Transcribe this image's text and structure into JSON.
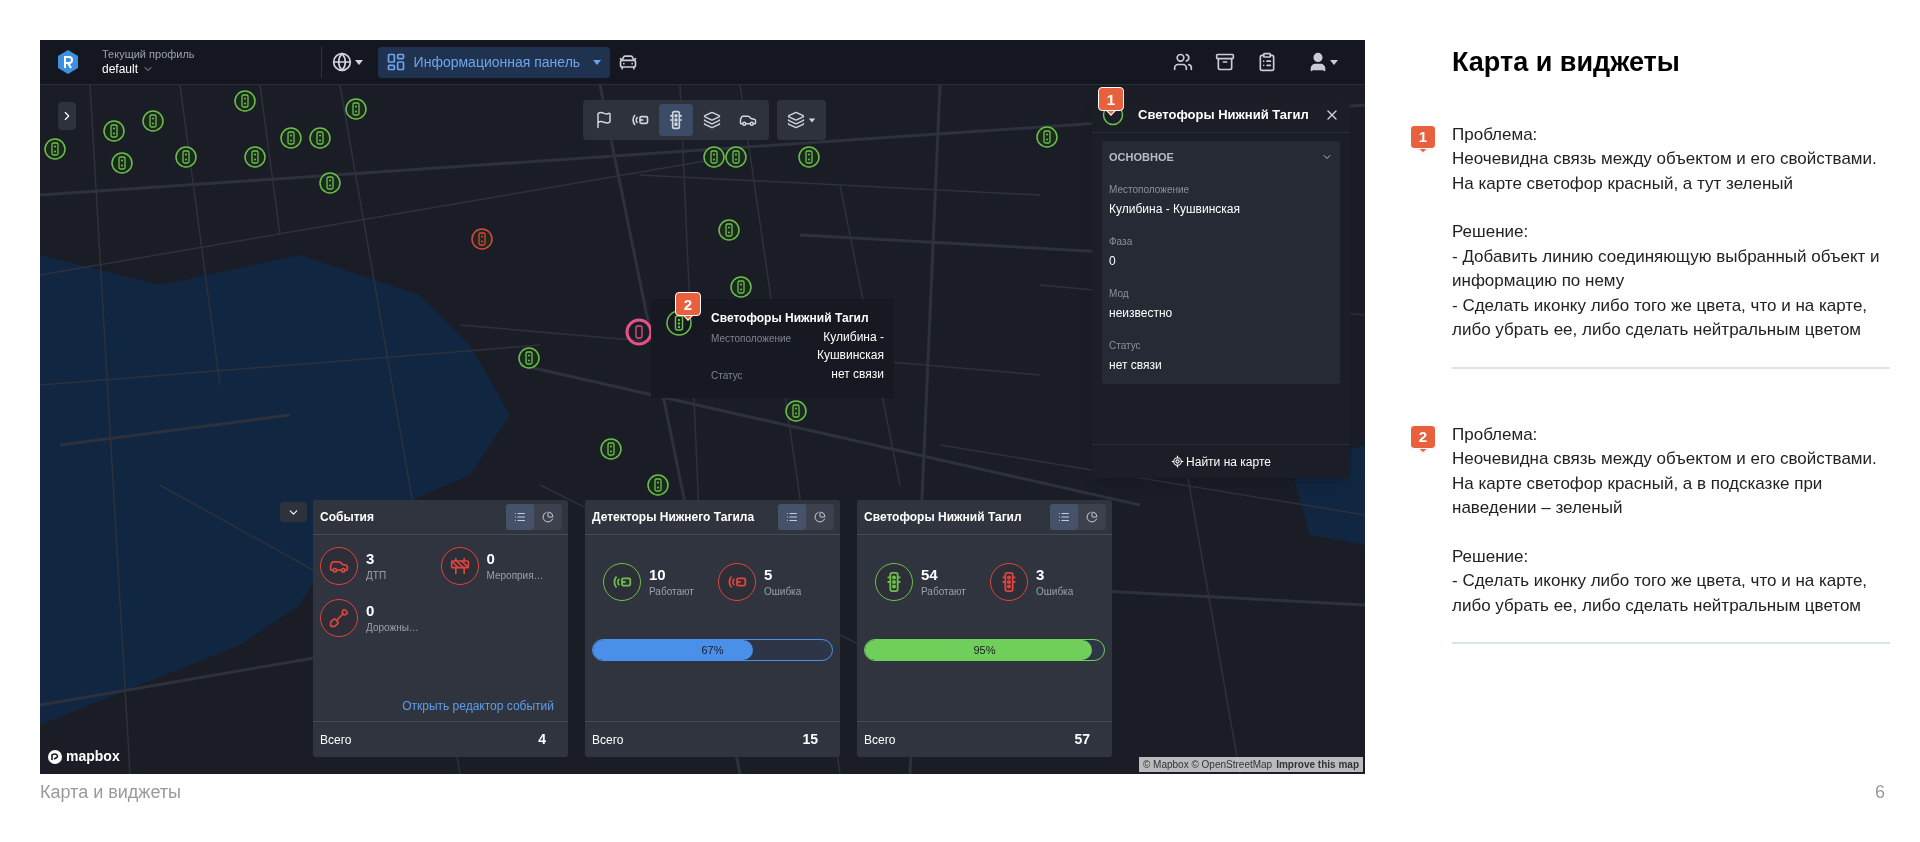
{
  "header": {
    "profile_label": "Текущий профиль",
    "profile_value": "default",
    "dashboard_button": "Информационная панель"
  },
  "map_toolbar": [
    {
      "kind": "flag",
      "selected": false
    },
    {
      "kind": "detector",
      "selected": false
    },
    {
      "kind": "traffic-light",
      "selected": true
    },
    {
      "kind": "layers",
      "selected": false
    },
    {
      "kind": "crash",
      "selected": false
    }
  ],
  "panel": {
    "callout": "1",
    "title": "Светофоры Нижний Тагил",
    "section": "ОСНОВНОЕ",
    "expanded": true,
    "fields": [
      {
        "label": "Местоположение",
        "value": "Кулибина - Кушвинская"
      },
      {
        "label": "Фаза",
        "value": "0"
      },
      {
        "label": "Мод",
        "value": "неизвестно"
      },
      {
        "label": "Статус",
        "value": "нет связи"
      }
    ],
    "find_button": "Найти на карте"
  },
  "tooltip": {
    "callout": "2",
    "title": "Светофоры Нижний Тагил",
    "rows": [
      {
        "label": "Местоположение",
        "value": "Кулибина - Кушвинская"
      },
      {
        "label": "Статус",
        "value": "нет связи"
      }
    ]
  },
  "widgets": [
    {
      "title": "События",
      "tabs": [
        {
          "kind": "list",
          "selected": true
        },
        {
          "kind": "chart",
          "selected": false
        }
      ],
      "stats": [
        {
          "value": "3",
          "label": "ДТП",
          "color": "#e0443c",
          "kind": "crash"
        },
        {
          "value": "0",
          "label": "Мероприя…",
          "color": "#e0443c",
          "kind": "barrier"
        },
        {
          "value": "0",
          "label": "Дорожны…",
          "color": "#e0443c",
          "kind": "roadwork"
        }
      ],
      "link": "Открыть редактор событий",
      "total_label": "Всего",
      "total": "4"
    },
    {
      "title": "Детекторы Нижнего Тагила",
      "tabs": [
        {
          "kind": "list",
          "selected": true
        },
        {
          "kind": "chart",
          "selected": false
        }
      ],
      "stats": [
        {
          "value": "10",
          "label": "Работают",
          "color": "#6cc04a",
          "kind": "detector"
        },
        {
          "value": "5",
          "label": "Ошибка",
          "color": "#e0443c",
          "kind": "detector"
        }
      ],
      "progress": {
        "level": 0.67,
        "label": "67%",
        "color": "#4a90ea"
      },
      "total_label": "Всего",
      "total": "15"
    },
    {
      "title": "Светофоры Нижний Тагил",
      "tabs": [
        {
          "kind": "list",
          "selected": true
        },
        {
          "kind": "chart",
          "selected": false
        }
      ],
      "stats": [
        {
          "value": "54",
          "label": "Работают",
          "color": "#6cc04a",
          "kind": "traffic-light"
        },
        {
          "value": "3",
          "label": "Ошибка",
          "color": "#e0443c",
          "kind": "traffic-light"
        }
      ],
      "progress": {
        "level": 0.95,
        "label": "95%",
        "color": "#6fcf5a"
      },
      "total_label": "Всего",
      "total": "57"
    }
  ],
  "map_attribution": {
    "logo": "mapbox",
    "credits": "© Mapbox © OpenStreetMap",
    "improve": "Improve this map"
  },
  "notes": {
    "title": "Карта и виджеты",
    "items": [
      {
        "number": "1",
        "problem_label": "Проблема:",
        "problem": [
          "Неочевидна связь между объектом и его свойствами.",
          "На карте светофор красный, а тут зеленый"
        ],
        "solution_label": "Решение:",
        "solution": [
          "- Добавить линию соединяющую выбранный объект и информацию по нему",
          "- Сделать иконку либо того же цвета, что и на карте, либо убрать ее, либо сделать нейтральным цветом"
        ]
      },
      {
        "number": "2",
        "problem_label": "Проблема:",
        "problem": [
          "Неочевидна связь между объектом и его свойствами.",
          "На карте светофор красный, а в подсказке при наведении – зеленый"
        ],
        "solution_label": "Решение:",
        "solution": [
          "- Сделать иконку либо того же цвета, что и на карте, либо убрать ее, либо сделать нейтральным цветом"
        ]
      }
    ]
  },
  "footer": {
    "caption": "Карта и виджеты",
    "page": "6"
  }
}
